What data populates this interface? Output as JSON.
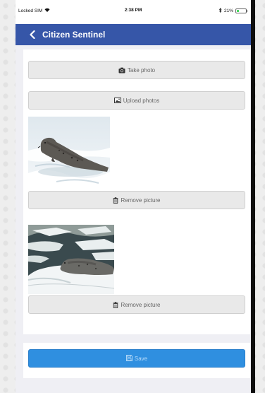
{
  "status_bar": {
    "carrier": "Locked SIM",
    "time": "2:38 PM",
    "battery": "21%",
    "battery_level": 0.21,
    "bluetooth_icon": "bluetooth-icon",
    "wifi_icon": "wifi-icon"
  },
  "nav": {
    "title": "Citizen Sentinel",
    "back_icon": "chevron-left-icon"
  },
  "actions": {
    "take_photo": "Take photo",
    "upload_photos": "Upload photos"
  },
  "pictures": [
    {
      "remove_label": "Remove picture"
    },
    {
      "remove_label": "Remove picture"
    }
  ],
  "save": {
    "label": "Save"
  },
  "colors": {
    "nav_bar": "#3656a8",
    "save_button": "#2f8fe0",
    "button_bg": "#e9e9e9",
    "screen_bg": "#efeff4"
  }
}
